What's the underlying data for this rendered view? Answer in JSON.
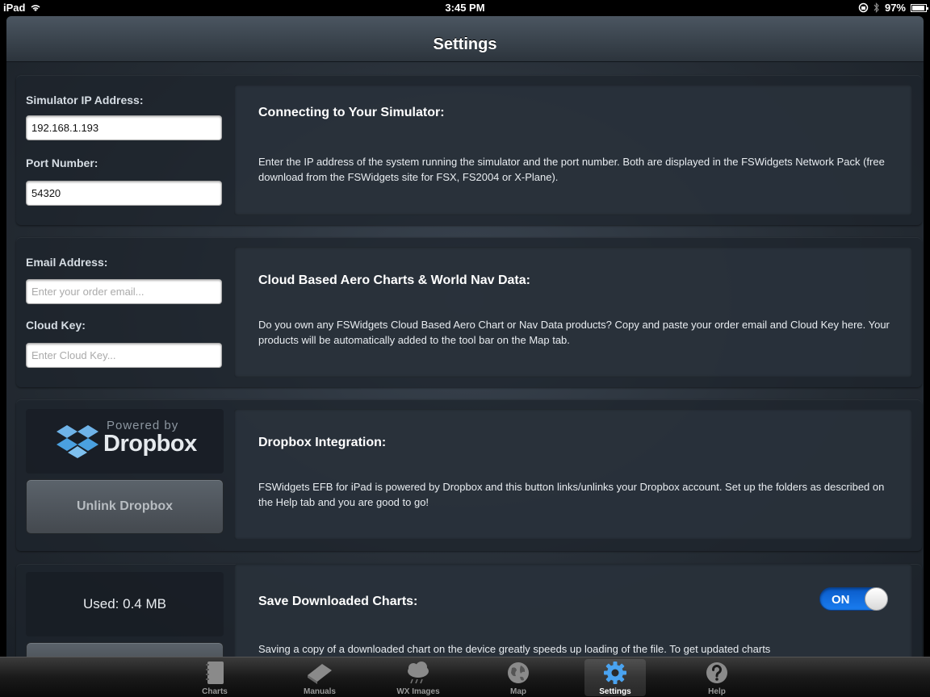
{
  "status_bar": {
    "device": "iPad",
    "time": "3:45 PM",
    "battery": "97%"
  },
  "nav": {
    "title": "Settings"
  },
  "simulator": {
    "ip_label": "Simulator IP Address:",
    "ip_value": "192.168.1.193",
    "port_label": "Port Number:",
    "port_value": "54320",
    "title": "Connecting to Your Simulator:",
    "text": "Enter the IP address of the system running the simulator and the port number. Both are displayed in the FSWidgets Network Pack (free download from the FSWidgets site for FSX, FS2004 or X-Plane)."
  },
  "cloud": {
    "email_label": "Email Address:",
    "email_placeholder": "Enter your order email...",
    "key_label": "Cloud Key:",
    "key_placeholder": "Enter Cloud Key...",
    "title": "Cloud Based Aero Charts & World Nav Data:",
    "text": "Do you own any FSWidgets Cloud Based Aero Chart or Nav Data products? Copy and paste your order email and Cloud Key here. Your products will be automatically added to the tool bar on the Map tab."
  },
  "dropbox": {
    "logo_small": "Powered by",
    "logo_big": "Dropbox",
    "unlink_label": "Unlink Dropbox",
    "title": "Dropbox Integration:",
    "text": "FSWidgets EFB for iPad is powered by Dropbox and this button links/unlinks your Dropbox account. Set up the folders as described on the Help tab and you are good to go!"
  },
  "save_charts": {
    "used": "Used: 0.4 MB",
    "title": "Save Downloaded Charts:",
    "toggle_label": "ON",
    "toggle_on": true,
    "text": "Saving a copy of a downloaded chart on the device greatly speeds up loading of the file. To get updated charts"
  },
  "tabs": [
    {
      "label": "Charts",
      "icon": "notebook-icon"
    },
    {
      "label": "Manuals",
      "icon": "book-icon"
    },
    {
      "label": "WX Images",
      "icon": "cloud-rain-icon"
    },
    {
      "label": "Map",
      "icon": "globe-icon"
    },
    {
      "label": "Settings",
      "icon": "gear-icon",
      "active": true
    },
    {
      "label": "Help",
      "icon": "question-icon"
    }
  ],
  "colors": {
    "accent": "#1a7df0",
    "tab_active": "#ffffff"
  }
}
